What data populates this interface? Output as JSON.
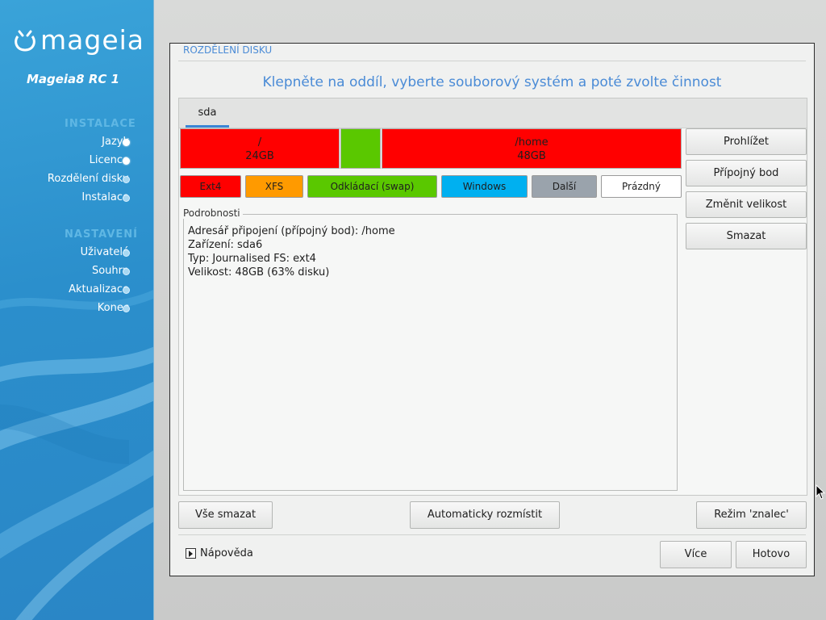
{
  "sidebar": {
    "logo_text": "mageia",
    "release": "Mageia8 RC 1",
    "sections": [
      {
        "title": "INSTALACE",
        "items": [
          {
            "label": "Jazyk",
            "state": "done"
          },
          {
            "label": "Licence",
            "state": "done"
          },
          {
            "label": "Rozdělení disku",
            "state": "pending"
          },
          {
            "label": "Instalace",
            "state": "pending"
          }
        ]
      },
      {
        "title": "NASTAVENÍ",
        "items": [
          {
            "label": "Uživatelé",
            "state": "pending"
          },
          {
            "label": "Souhrn",
            "state": "pending"
          },
          {
            "label": "Aktualizace",
            "state": "pending"
          },
          {
            "label": "Konec",
            "state": "pending"
          }
        ]
      }
    ]
  },
  "panel": {
    "title": "ROZDĚLENÍ DISKU",
    "headline": "Klepněte na oddíl, vyberte souborový systém a poté zvolte činnost"
  },
  "disk": {
    "tab": "sda",
    "partitions": [
      {
        "mount": "/",
        "size": "24GB",
        "color": "#ff0000"
      },
      {
        "mount": "",
        "size": "",
        "color": "#5ac800"
      },
      {
        "mount": "/home",
        "size": "48GB",
        "color": "#ff0000"
      }
    ],
    "legend": [
      {
        "label": "Ext4",
        "color": "#ff0000"
      },
      {
        "label": "XFS",
        "color": "#ff9a00"
      },
      {
        "label": "Odkládací (swap)",
        "color": "#5ac800"
      },
      {
        "label": "Windows",
        "color": "#00b0f0"
      },
      {
        "label": "Další",
        "color": "#9aa3ac"
      },
      {
        "label": "Prázdný",
        "color": "#ffffff"
      }
    ]
  },
  "details": {
    "label": "Podrobnosti",
    "lines": [
      "Adresář připojení (přípojný bod): /home",
      "Zařízení: sda6",
      "Typ: Journalised FS: ext4",
      "Velikost: 48GB (63% disku)"
    ]
  },
  "actions": {
    "browse": "Prohlížet",
    "mount_point": "Přípojný bod",
    "resize": "Změnit velikost",
    "delete": "Smazat"
  },
  "footer": {
    "clear_all": "Vše smazat",
    "auto_allocate": "Automaticky rozmístit",
    "expert_mode": "Režim 'znalec'",
    "help": "Nápověda",
    "more": "Více",
    "done": "Hotovo"
  },
  "colors": {
    "accent": "#4a8bd6",
    "tab_underline": "#3b86d6",
    "sidebar": "#2b8fcc"
  }
}
